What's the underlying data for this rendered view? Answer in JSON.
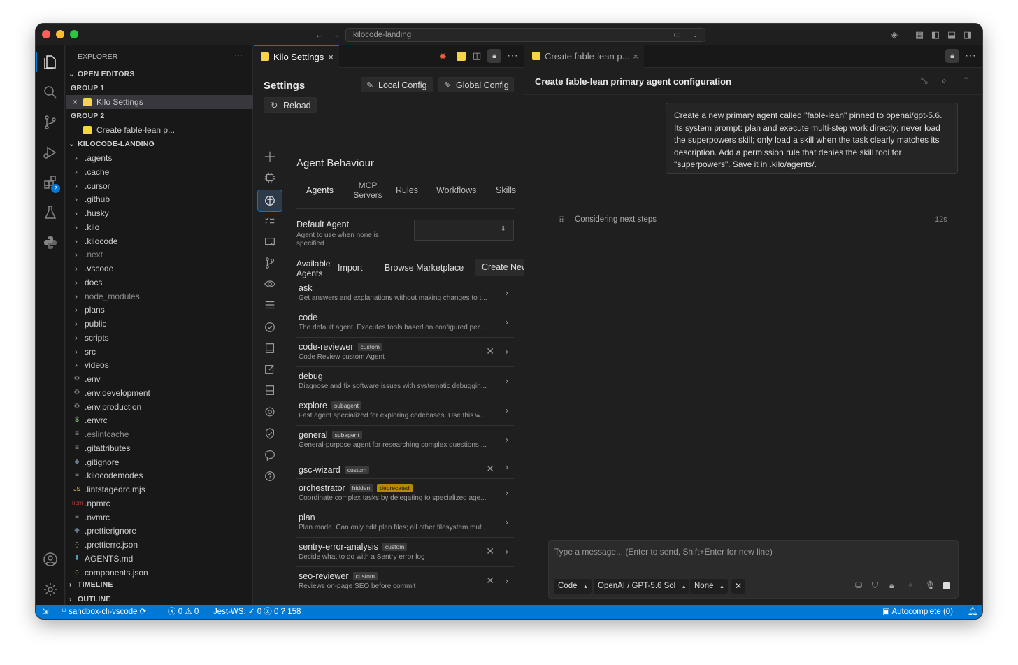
{
  "window": {
    "address": "kilocode-landing"
  },
  "explorer": {
    "title": "EXPLORER",
    "open_editors": "OPEN EDITORS",
    "group1": "GROUP 1",
    "group1_file": "Kilo Settings",
    "group2": "GROUP 2",
    "group2_file": "Create fable-lean p...",
    "project": "KILOCODE-LANDING",
    "folders": [
      ".agents",
      ".cache",
      ".cursor",
      ".github",
      ".husky",
      ".kilo",
      ".kilocode",
      ".next",
      ".vscode",
      "docs",
      "node_modules",
      "plans",
      "public",
      "scripts",
      "src",
      "videos"
    ],
    "files": [
      {
        "name": ".env",
        "icon": "gear"
      },
      {
        "name": ".env.development",
        "icon": "gear"
      },
      {
        "name": ".env.production",
        "icon": "gear"
      },
      {
        "name": ".envrc",
        "icon": "$"
      },
      {
        "name": ".eslintcache",
        "icon": "lines"
      },
      {
        "name": ".gitattributes",
        "icon": "lines"
      },
      {
        "name": ".gitignore",
        "icon": "diamond"
      },
      {
        "name": ".kilocodemodes",
        "icon": "lines"
      },
      {
        "name": ".lintstagedrc.mjs",
        "icon": "JS"
      },
      {
        "name": ".npmrc",
        "icon": "npm"
      },
      {
        "name": ".nvmrc",
        "icon": "lines"
      },
      {
        "name": ".prettierignore",
        "icon": "diamond"
      },
      {
        "name": ".prettierrc.json",
        "icon": "{}"
      },
      {
        "name": "AGENTS.md",
        "icon": "down-arrow"
      },
      {
        "name": "components.json",
        "icon": "{}"
      }
    ],
    "timeline": "TIMELINE",
    "outline": "OUTLINE"
  },
  "settings": {
    "tab_label": "Kilo Settings",
    "title": "Settings",
    "local_config": "Local Config",
    "global_config": "Global Config",
    "reload": "Reload",
    "section": "Agent Behaviour",
    "tabs": [
      "Agents",
      "MCP Servers",
      "Rules",
      "Workflows",
      "Skills"
    ],
    "default_agent_label": "Default Agent",
    "default_agent_desc": "Agent to use when none is specified",
    "available_label": "Available Agents",
    "import": "Import",
    "browse": "Browse Marketplace",
    "create_new": "Create New",
    "agents": [
      {
        "name": "ask",
        "desc": "Get answers and explanations without making changes to t...",
        "badges": [],
        "removable": false
      },
      {
        "name": "code",
        "desc": "The default agent. Executes tools based on configured per...",
        "badges": [],
        "removable": false
      },
      {
        "name": "code-reviewer",
        "desc": "Code Review custom Agent",
        "badges": [
          "custom"
        ],
        "removable": true
      },
      {
        "name": "debug",
        "desc": "Diagnose and fix software issues with systematic debuggin...",
        "badges": [],
        "removable": false
      },
      {
        "name": "explore",
        "desc": "Fast agent specialized for exploring codebases. Use this w...",
        "badges": [
          "subagent"
        ],
        "removable": false
      },
      {
        "name": "general",
        "desc": "General-purpose agent for researching complex questions ...",
        "badges": [
          "subagent"
        ],
        "removable": false
      },
      {
        "name": "gsc-wizard",
        "desc": "",
        "badges": [
          "custom"
        ],
        "removable": true
      },
      {
        "name": "orchestrator",
        "desc": "Coordinate complex tasks by delegating to specialized age...",
        "badges": [
          "hidden",
          "deprecated"
        ],
        "removable": false
      },
      {
        "name": "plan",
        "desc": "Plan mode. Can only edit plan files; all other filesystem mut...",
        "badges": [],
        "removable": false
      },
      {
        "name": "sentry-error-analysis",
        "desc": "Decide what to do with a Sentry error log",
        "badges": [
          "custom"
        ],
        "removable": true
      },
      {
        "name": "seo-reviewer",
        "desc": "Reviews on-page SEO before commit",
        "badges": [
          "custom"
        ],
        "removable": true
      }
    ]
  },
  "chat": {
    "tab_label": "Create fable-lean p...",
    "header": "Create fable-lean primary agent configuration",
    "message": "Create a new primary agent called \"fable-lean\" pinned to openai/gpt-5.6. Its system prompt: plan and execute multi-step work directly; never load the superpowers skill; only load a skill when the task clearly matches its description. Add a permission rule that denies the skill tool for \"superpowers\". Save it in .kilo/agents/.",
    "status": "Considering next steps",
    "elapsed": "12s",
    "input_placeholder": "Type a message... (Enter to send, Shift+Enter for new line)",
    "mode": "Code",
    "model": "OpenAI / GPT-5.6 Sol",
    "variant": "None"
  },
  "statusbar": {
    "branch": "sandbox-cli-vscode",
    "errors": "0",
    "warnings": "0",
    "jest": "Jest-WS:",
    "jest_pass": "0",
    "jest_fail": "0",
    "jest_unknown": "158",
    "autocomplete": "Autocomplete (0)"
  },
  "colors": {
    "accent": "#0078d4",
    "badge_deprecated": "#b58900",
    "kilo_yellow": "#f5d547"
  }
}
